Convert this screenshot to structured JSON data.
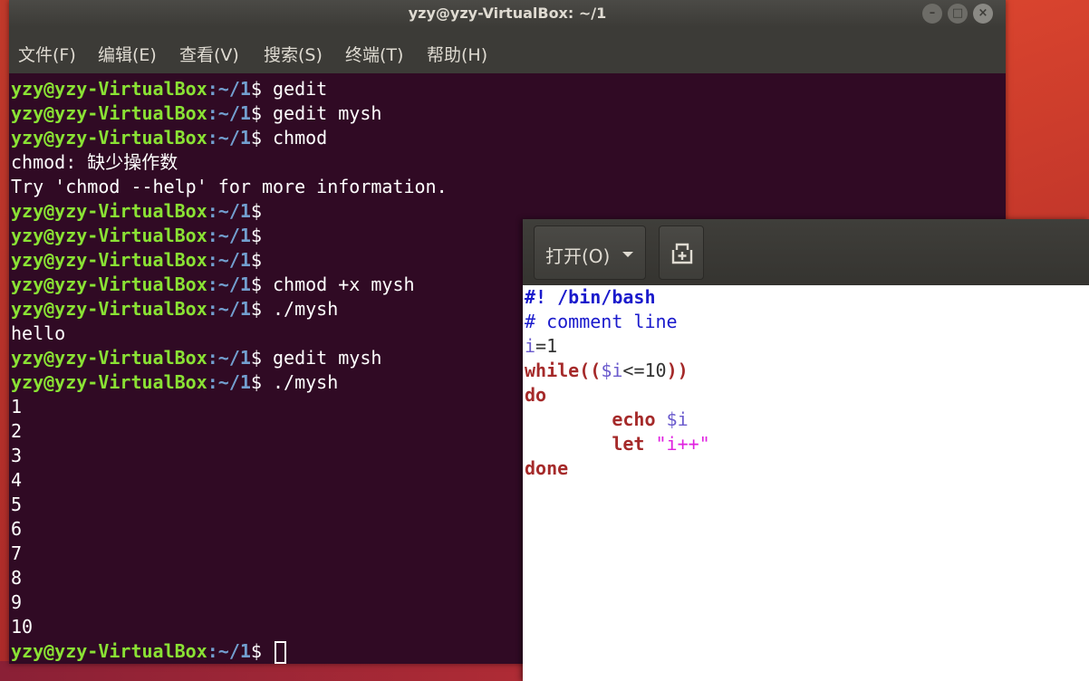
{
  "window": {
    "title": "yzy@yzy-VirtualBox: ~/1",
    "buttons": {
      "minimize": "–",
      "maximize": "□",
      "close": "×"
    }
  },
  "menu": {
    "items": [
      "文件(F)",
      "编辑(E)",
      "查看(V)",
      "搜索(S)",
      "终端(T)",
      "帮助(H)"
    ]
  },
  "terminal": {
    "prompt_user": "yzy@yzy-VirtualBox",
    "prompt_path": ":~/1",
    "prompt_symbol": "$",
    "lines": [
      {
        "type": "prompt",
        "cmd": " gedit"
      },
      {
        "type": "prompt",
        "cmd": " gedit mysh"
      },
      {
        "type": "prompt",
        "cmd": " chmod"
      },
      {
        "type": "output",
        "text": "chmod: 缺少操作数"
      },
      {
        "type": "output",
        "text": "Try 'chmod --help' for more information."
      },
      {
        "type": "prompt",
        "cmd": ""
      },
      {
        "type": "prompt",
        "cmd": ""
      },
      {
        "type": "prompt",
        "cmd": ""
      },
      {
        "type": "prompt",
        "cmd": " chmod +x mysh"
      },
      {
        "type": "prompt",
        "cmd": " ./mysh"
      },
      {
        "type": "output",
        "text": "hello"
      },
      {
        "type": "prompt",
        "cmd": " gedit mysh"
      },
      {
        "type": "prompt",
        "cmd": " ./mysh"
      },
      {
        "type": "output",
        "text": "1"
      },
      {
        "type": "output",
        "text": "2"
      },
      {
        "type": "output",
        "text": "3"
      },
      {
        "type": "output",
        "text": "4"
      },
      {
        "type": "output",
        "text": "5"
      },
      {
        "type": "output",
        "text": "6"
      },
      {
        "type": "output",
        "text": "7"
      },
      {
        "type": "output",
        "text": "8"
      },
      {
        "type": "output",
        "text": "9"
      },
      {
        "type": "output",
        "text": "10"
      },
      {
        "type": "prompt",
        "cmd": " ",
        "cursor": true
      }
    ]
  },
  "gedit": {
    "open_label": "打开(O)",
    "new_tab_icon": "new-document-icon",
    "code": [
      [
        {
          "t": "#! /bin/bash",
          "c": "shebang"
        }
      ],
      [
        {
          "t": "# comment line",
          "c": "comment"
        }
      ],
      [
        {
          "t": "i",
          "c": "var"
        },
        {
          "t": "=1",
          "c": "num"
        }
      ],
      [
        {
          "t": "while",
          "c": "kw"
        },
        {
          "t": "((",
          "c": "kw"
        },
        {
          "t": "$i",
          "c": "var"
        },
        {
          "t": "<=10",
          "c": "num"
        },
        {
          "t": "))",
          "c": "kw"
        }
      ],
      [
        {
          "t": "do",
          "c": "kw"
        }
      ],
      [
        {
          "t": "        ",
          "c": "plain"
        },
        {
          "t": "echo",
          "c": "kw"
        },
        {
          "t": " ",
          "c": "plain"
        },
        {
          "t": "$i",
          "c": "var"
        }
      ],
      [
        {
          "t": "        ",
          "c": "plain"
        },
        {
          "t": "let",
          "c": "kw"
        },
        {
          "t": " ",
          "c": "plain"
        },
        {
          "t": "\"i++\"",
          "c": "str"
        }
      ],
      [
        {
          "t": "done",
          "c": "kw"
        }
      ]
    ]
  },
  "colors": {
    "terminal_bg": "#300a24",
    "prompt_user": "#8ae234",
    "prompt_path": "#729fcf",
    "titlebar": "#3c3b37"
  }
}
